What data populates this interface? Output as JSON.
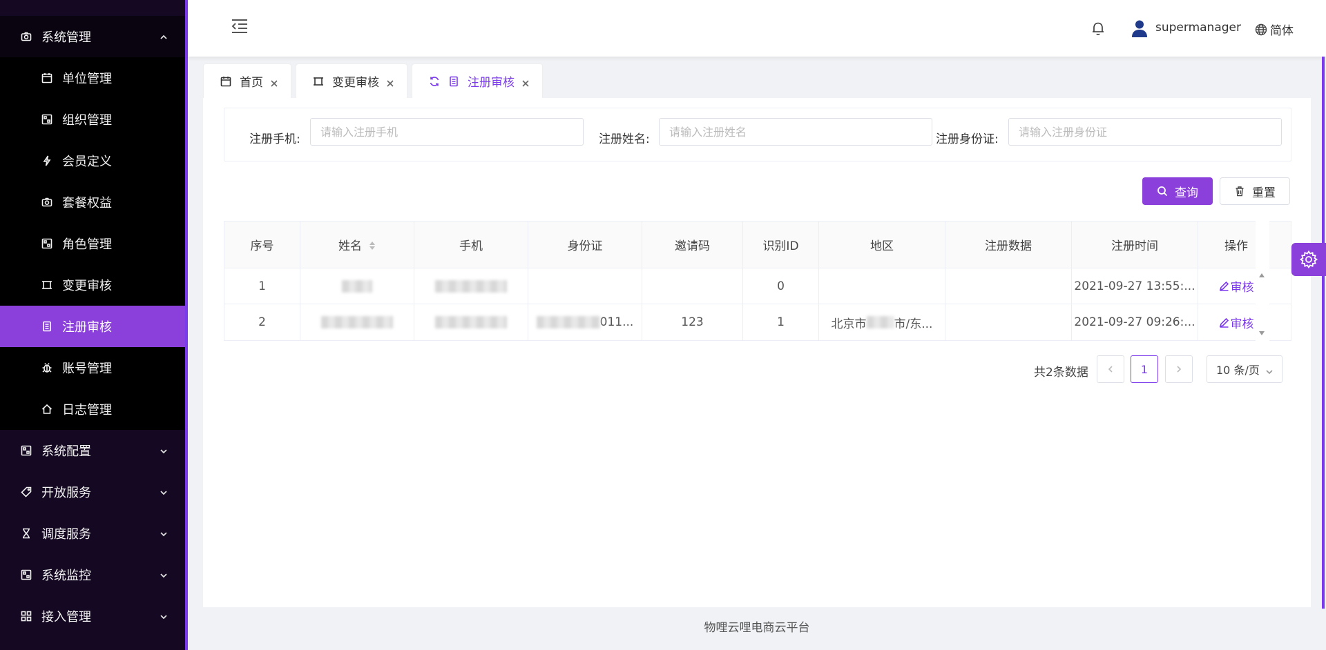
{
  "sidebar": {
    "partial_top_label": "",
    "section": {
      "label": "系统管理",
      "icon": "camera-icon"
    },
    "sub_items": [
      {
        "label": "单位管理",
        "icon": "calendar-icon"
      },
      {
        "label": "组织管理",
        "icon": "grid-icon"
      },
      {
        "label": "会员定义",
        "icon": "bolt-icon"
      },
      {
        "label": "套餐权益",
        "icon": "camera-icon"
      },
      {
        "label": "角色管理",
        "icon": "grid-icon"
      },
      {
        "label": "变更审核",
        "icon": "frame-icon"
      },
      {
        "label": "注册审核",
        "icon": "document-icon",
        "active": true
      },
      {
        "label": "账号管理",
        "icon": "bug-icon"
      },
      {
        "label": "日志管理",
        "icon": "home-icon"
      }
    ],
    "groups": [
      {
        "label": "系统配置",
        "icon": "grid-icon"
      },
      {
        "label": "开放服务",
        "icon": "tag-icon"
      },
      {
        "label": "调度服务",
        "icon": "hourglass-icon"
      },
      {
        "label": "系统监控",
        "icon": "grid-icon"
      },
      {
        "label": "接入管理",
        "icon": "apps-icon"
      }
    ]
  },
  "header": {
    "username": "supermanager",
    "language": "简体"
  },
  "tabs": [
    {
      "label": "首页",
      "icon": "calendar-icon"
    },
    {
      "label": "变更审核",
      "icon": "frame-icon"
    },
    {
      "label": "注册审核",
      "icon": "document-icon",
      "active": true
    }
  ],
  "filters": {
    "phone": {
      "label": "注册手机:",
      "placeholder": "请输入注册手机"
    },
    "name": {
      "label": "注册姓名:",
      "placeholder": "请输入注册姓名"
    },
    "idcard": {
      "label": "注册身份证:",
      "placeholder": "请输入注册身份证"
    }
  },
  "buttons": {
    "query": "查询",
    "reset": "重置"
  },
  "table": {
    "columns": [
      "序号",
      "姓名",
      "手机",
      "身份证",
      "邀请码",
      "识别ID",
      "地区",
      "注册数据",
      "注册时间",
      "操作"
    ],
    "rows": [
      {
        "index": "1",
        "name": "",
        "phone": "",
        "idcard": "",
        "invite": "",
        "rid": "0",
        "region": "",
        "data": "",
        "time": "2021-09-27 13:55:...",
        "action": "审核"
      },
      {
        "index": "2",
        "name": "",
        "phone": "",
        "idcard": "011...",
        "invite": "123",
        "rid": "1",
        "region": "北京市",
        "region_tail": "市/东...",
        "data": "",
        "time": "2021-09-27 09:26:...",
        "action": "审核"
      }
    ]
  },
  "pagination": {
    "total": "共2条数据",
    "current_page": "1",
    "page_size": "10 条/页"
  },
  "footer": "物哩云哩电商云平台",
  "colors": {
    "accent": "#8b3fdb",
    "sidebar_bg": "#150822"
  }
}
